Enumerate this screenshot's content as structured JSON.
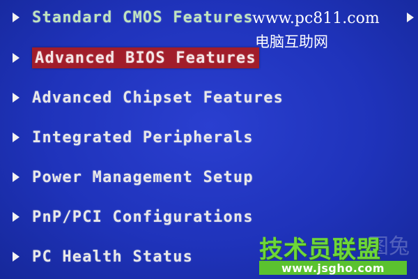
{
  "menu": {
    "items": [
      {
        "label": "Standard CMOS Features",
        "selected": false
      },
      {
        "label": "Advanced BIOS Features",
        "selected": true
      },
      {
        "label": "Advanced Chipset Features",
        "selected": false
      },
      {
        "label": "Integrated Peripherals",
        "selected": false
      },
      {
        "label": "Power Management Setup",
        "selected": false
      },
      {
        "label": "PnP/PCI Configurations",
        "selected": false
      },
      {
        "label": "PC Health Status",
        "selected": false
      }
    ]
  },
  "watermark": {
    "site_url": "www.pc811.com",
    "site_name_cn": "电脑互助网"
  },
  "watermark2": {
    "brand_cn": "技术员联盟",
    "url": "www.jsgho.com",
    "faint_text": "图兔"
  },
  "colors": {
    "background": "#1c2fb0",
    "selected_bar": "#a11d2a",
    "text": "#e8e8e8",
    "watermark_green": "#6dd63a"
  },
  "icons": {
    "item_marker": "triangle-right-icon"
  }
}
